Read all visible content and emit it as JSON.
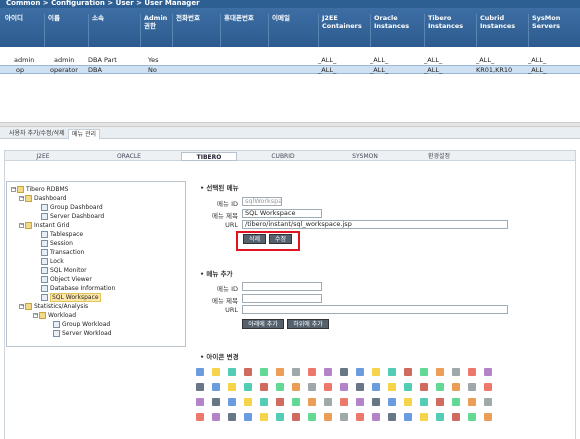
{
  "breadcrumb": "Common > Configuration > User > User Manager",
  "table": {
    "headers": [
      "아이디",
      "이름",
      "소속",
      "Admin 권한",
      "전화번호",
      "휴대폰번호",
      "이메일",
      "J2EE Containers",
      "Oracle Instances",
      "Tibero Instances",
      "Cubrid Instances",
      "SysMon Servers"
    ],
    "rows": [
      [
        "admin",
        "admin",
        "DBA Part",
        "Yes",
        "",
        "",
        "",
        "_ALL_",
        "_ALL_",
        "_ALL_",
        "_ALL_",
        "_ALL_"
      ],
      [
        "op",
        "operator",
        "DBA",
        "No",
        "",
        "",
        "",
        "_ALL_",
        "_ALL_",
        "_ALL_",
        "KR01,KR10",
        "_ALL_"
      ]
    ],
    "selected_row": 1
  },
  "subtabs": [
    "사용자 추가/수정/삭제",
    "메뉴 관리"
  ],
  "active_subtab": 1,
  "db_tabs": [
    "J2EE",
    "ORACLE",
    "TIBERO",
    "CUBRID",
    "SYSMON",
    "환경설정"
  ],
  "active_db_tab": 2,
  "tree": {
    "root": "Tibero RDBMS",
    "items": [
      {
        "label": "Dashboard",
        "level": 1,
        "folder": true
      },
      {
        "label": "Group Dashboard",
        "level": 2
      },
      {
        "label": "Server Dashboard",
        "level": 2
      },
      {
        "label": "Instant Grid",
        "level": 1,
        "folder": true
      },
      {
        "label": "Tablespace",
        "level": 2
      },
      {
        "label": "Session",
        "level": 2
      },
      {
        "label": "Transaction",
        "level": 2
      },
      {
        "label": "Lock",
        "level": 2
      },
      {
        "label": "SQL Monitor",
        "level": 2
      },
      {
        "label": "Object Viewer",
        "level": 2
      },
      {
        "label": "Database Information",
        "level": 2
      },
      {
        "label": "SQL Workspace",
        "level": 2,
        "selected": true
      },
      {
        "label": "Statistics/Analysis",
        "level": 1,
        "folder": true
      },
      {
        "label": "Workload",
        "level": 2,
        "folder": true
      },
      {
        "label": "Group Workload",
        "level": 3
      },
      {
        "label": "Server Workload",
        "level": 3
      }
    ]
  },
  "selected_menu": {
    "title": "선택된 메뉴",
    "id_label": "메뉴 ID",
    "id_value": "sqlWorkspace",
    "name_label": "메뉴 제목",
    "name_value": "SQL Workspace",
    "url_label": "URL",
    "url_value": "/tibero/instant/sql_workspace.jsp",
    "delete_label": "삭제",
    "edit_label": "수정"
  },
  "add_menu": {
    "title": "메뉴 추가",
    "id_label": "메뉴 ID",
    "name_label": "메뉴 제목",
    "url_label": "URL",
    "add_below_label": "아래에 추가",
    "add_child_label": "하위에 추가"
  },
  "icon_section": {
    "title": "아이콘 변경"
  },
  "colors": {
    "header": "#2e5f93",
    "selected_row": "#cfe0f2",
    "highlight_box": "#e0141f",
    "button": "#55616d"
  }
}
